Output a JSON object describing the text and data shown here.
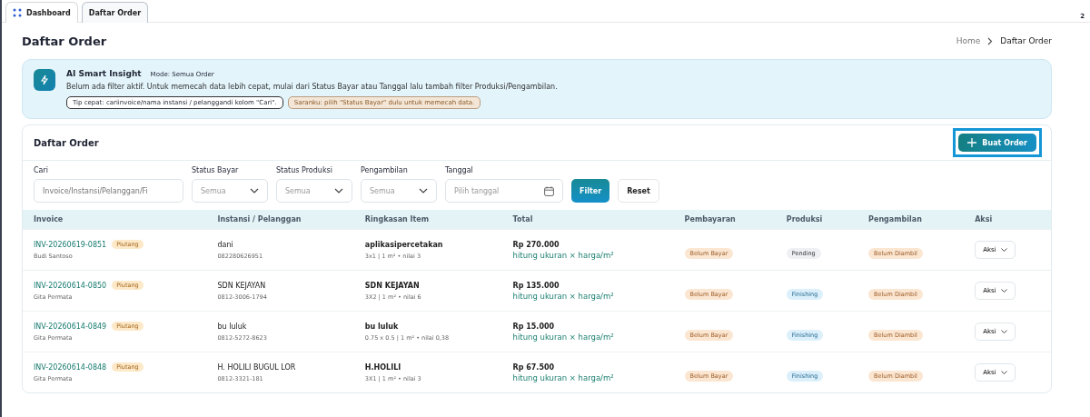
{
  "tabs": [
    {
      "label": "Dashboard",
      "icon": true,
      "selected": false
    },
    {
      "label": "Daftar Order",
      "icon": false,
      "selected": true
    }
  ],
  "corner_badge": "2",
  "page_title": "Daftar Order",
  "breadcrumb": [
    "Home",
    "Daftar Order"
  ],
  "insight": {
    "title": "AI Smart Insight",
    "mode": "Mode: Semua Order",
    "message": "Belum ada filter aktif. Untuk memecah data lebih cepat, mulai dari Status Bayar atau Tanggal lalu tambah filter Produksi/Pengambilan.",
    "chips": [
      {
        "text": "Tip cepat: cariinvoice/nama instansi / pelanggandi kolom \"Cari\".",
        "kind": "neutral"
      },
      {
        "text": "Saranku: pilih \"Status Bayar\" dulu untuk memecah data.",
        "kind": "warning"
      }
    ]
  },
  "card": {
    "title": "Daftar Order",
    "create_button": {
      "label": "Buat Order",
      "highlighted": true
    }
  },
  "filters": [
    {
      "label": "Cari",
      "kind": "text",
      "placeholder": "Invoice/Instansi/Pelanggan/Fi"
    },
    {
      "label": "Status Bayar",
      "kind": "select",
      "value": "Semua"
    },
    {
      "label": "Status Produksi",
      "kind": "select",
      "value": "Semua"
    },
    {
      "label": "Pengambilan",
      "kind": "select",
      "value": "Semua"
    },
    {
      "label": "Tanggal",
      "kind": "date",
      "placeholder": "Pilih tanggal"
    }
  ],
  "filter_buttons": [
    {
      "label": "Filter",
      "kind": "primary"
    },
    {
      "label": "Reset",
      "kind": "secondary"
    }
  ],
  "table": {
    "columns": [
      "Invoice",
      "Instansi / Pelanggan",
      "Ringkasan Item",
      "Total",
      "Pembayaran",
      "Produksi",
      "Pengambilan",
      "Aksi"
    ],
    "rows": [
      {
        "invoice": "INV-20260619-0851",
        "tag": "Piutang",
        "staff": "Budi Santoso",
        "customer": "dani",
        "phone": "082280626951",
        "item": "aplikasipercetakan",
        "item_detail": "3x1 | 1 m² • nilai 3",
        "total": "Rp 270.000",
        "total_note": "hitung ukuran × harga/m²",
        "payment": {
          "text": "Belum Bayar",
          "kind": "warning"
        },
        "production": {
          "text": "Pending",
          "kind": "neutral"
        },
        "pickup": {
          "text": "Belum Diambil",
          "kind": "warning"
        },
        "action": "Aksi"
      },
      {
        "invoice": "INV-20260614-0850",
        "tag": "Piutang",
        "staff": "Gita Permata",
        "customer": "SDN KEJAYAN",
        "phone": "0812-3006-1794",
        "item": "SDN KEJAYAN",
        "item_detail": "3X2 | 1 m² • nilai 6",
        "total": "Rp 135.000",
        "total_note": "hitung ukuran × harga/m²",
        "payment": {
          "text": "Belum Bayar",
          "kind": "warning"
        },
        "production": {
          "text": "Finishing",
          "kind": "info"
        },
        "pickup": {
          "text": "Belum Diambil",
          "kind": "warning"
        },
        "action": "Aksi"
      },
      {
        "invoice": "INV-20260614-0849",
        "tag": "Piutang",
        "staff": "Gita Permata",
        "customer": "bu luluk",
        "phone": "0812-5272-8623",
        "item": "bu luluk",
        "item_detail": "0.75 x 0.5 | 1 m² • nilai 0,38",
        "total": "Rp 15.000",
        "total_note": "hitung ukuran × harga/m²",
        "payment": {
          "text": "Belum Bayar",
          "kind": "warning"
        },
        "production": {
          "text": "Finishing",
          "kind": "info"
        },
        "pickup": {
          "text": "Belum Diambil",
          "kind": "warning"
        },
        "action": "Aksi"
      },
      {
        "invoice": "INV-20260614-0848",
        "tag": "Piutang",
        "staff": "Gita Permata",
        "customer": "H. HOLILI BUGUL LOR",
        "phone": "0812-3321-181",
        "item": "H.HOLILI",
        "item_detail": "3X1 | 1 m² • nilai 3",
        "total": "Rp 67.500",
        "total_note": "hitung ukuran × harga/m²",
        "payment": {
          "text": "Belum Bayar",
          "kind": "warning"
        },
        "production": {
          "text": "Finishing",
          "kind": "info"
        },
        "pickup": {
          "text": "Belum Diambil",
          "kind": "warning"
        },
        "action": "Aksi"
      }
    ]
  }
}
